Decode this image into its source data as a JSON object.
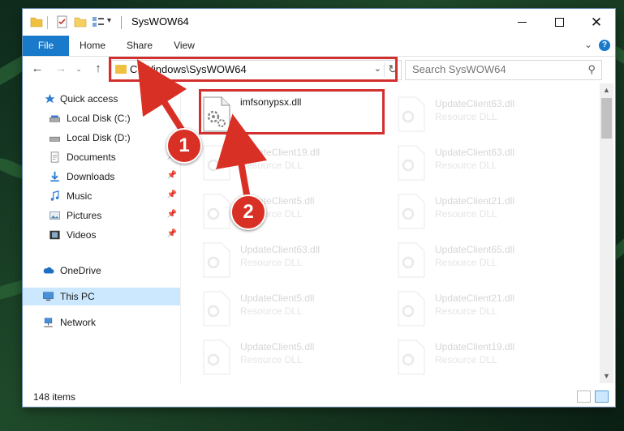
{
  "window": {
    "title": "SysWOW64"
  },
  "ribbon": {
    "tabs": [
      "File",
      "Home",
      "Share",
      "View"
    ],
    "help_label": "?"
  },
  "nav": {
    "address_path": "C:\\Windows\\SysWOW64",
    "search_placeholder": "Search SysWOW64"
  },
  "sidebar": {
    "items": [
      {
        "label": "Quick access",
        "icon": "star-icon"
      },
      {
        "label": "Local Disk (C:)",
        "icon": "drive-icon"
      },
      {
        "label": "Local Disk (D:)",
        "icon": "drive-icon"
      },
      {
        "label": "Documents",
        "icon": "documents-icon"
      },
      {
        "label": "Downloads",
        "icon": "download-icon"
      },
      {
        "label": "Music",
        "icon": "music-icon"
      },
      {
        "label": "Pictures",
        "icon": "pictures-icon"
      },
      {
        "label": "Videos",
        "icon": "videos-icon"
      },
      {
        "label": "OneDrive",
        "icon": "cloud-icon"
      },
      {
        "label": "This PC",
        "icon": "computer-icon"
      },
      {
        "label": "Network",
        "icon": "network-icon"
      }
    ],
    "selected": "This PC"
  },
  "files": [
    {
      "name": "imfsonypsx.dll",
      "type": ""
    },
    {
      "name": "UpdateClient63.dll",
      "type": "Resource DLL"
    },
    {
      "name": "UpdateClient19.dll",
      "type": "Resource DLL"
    },
    {
      "name": "UpdateClient63.dll",
      "type": "Resource DLL"
    },
    {
      "name": "UpdateClient5.dll",
      "type": "Resource DLL"
    },
    {
      "name": "UpdateClient21.dll",
      "type": "Resource DLL"
    },
    {
      "name": "UpdateClient63.dll",
      "type": "Resource DLL"
    },
    {
      "name": "UpdateClient65.dll",
      "type": "Resource DLL"
    },
    {
      "name": "UpdateClient5.dll",
      "type": "Resource DLL"
    },
    {
      "name": "UpdateClient21.dll",
      "type": "Resource DLL"
    },
    {
      "name": "UpdateClient5.dll",
      "type": "Resource DLL"
    },
    {
      "name": "UpdateClient19.dll",
      "type": "Resource DLL"
    }
  ],
  "status": {
    "item_count": "148 items"
  },
  "annotations": {
    "step1": "1",
    "step2": "2",
    "color": "#d32f2f"
  },
  "colors": {
    "accent": "#1979ca",
    "selection": "#cce8ff"
  }
}
